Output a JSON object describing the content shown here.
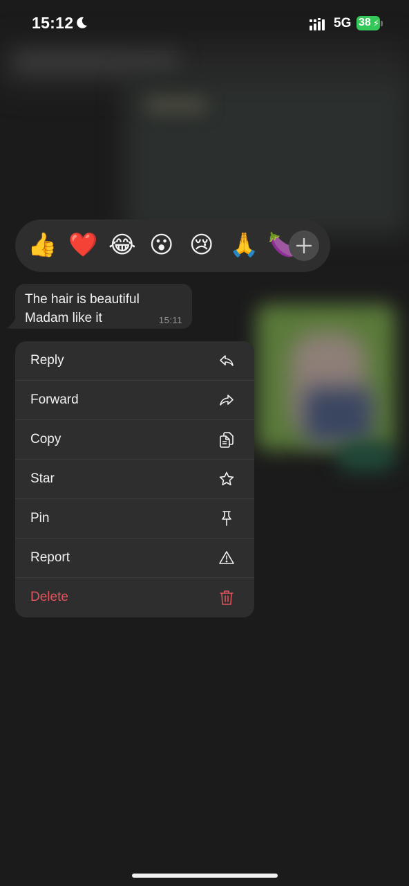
{
  "status_bar": {
    "time": "15:12",
    "network": "5G",
    "battery": "38"
  },
  "reactions": {
    "items": [
      {
        "name": "thumbs-up",
        "emoji": "👍"
      },
      {
        "name": "red-heart",
        "emoji": "❤️"
      },
      {
        "name": "tears-of-joy",
        "emoji": "😂"
      },
      {
        "name": "surprised",
        "emoji": "😮"
      },
      {
        "name": "crying",
        "emoji": "😢"
      },
      {
        "name": "folded-hands",
        "emoji": "🙏"
      },
      {
        "name": "eggplant",
        "emoji": "🍆"
      }
    ],
    "more_icon": "plus-icon"
  },
  "message": {
    "text": "The hair is beautiful\nMadam like it",
    "time": "15:11"
  },
  "menu": {
    "items": [
      {
        "label": "Reply",
        "icon": "reply-icon"
      },
      {
        "label": "Forward",
        "icon": "forward-icon"
      },
      {
        "label": "Copy",
        "icon": "copy-icon"
      },
      {
        "label": "Star",
        "icon": "star-icon"
      },
      {
        "label": "Pin",
        "icon": "pin-icon"
      },
      {
        "label": "Report",
        "icon": "warning-icon"
      },
      {
        "label": "Delete",
        "icon": "trash-icon"
      }
    ]
  },
  "colors": {
    "background": "#1b1b1b",
    "surface": "#2e2e2e",
    "destructive": "#e0555c",
    "battery": "#34c759"
  }
}
